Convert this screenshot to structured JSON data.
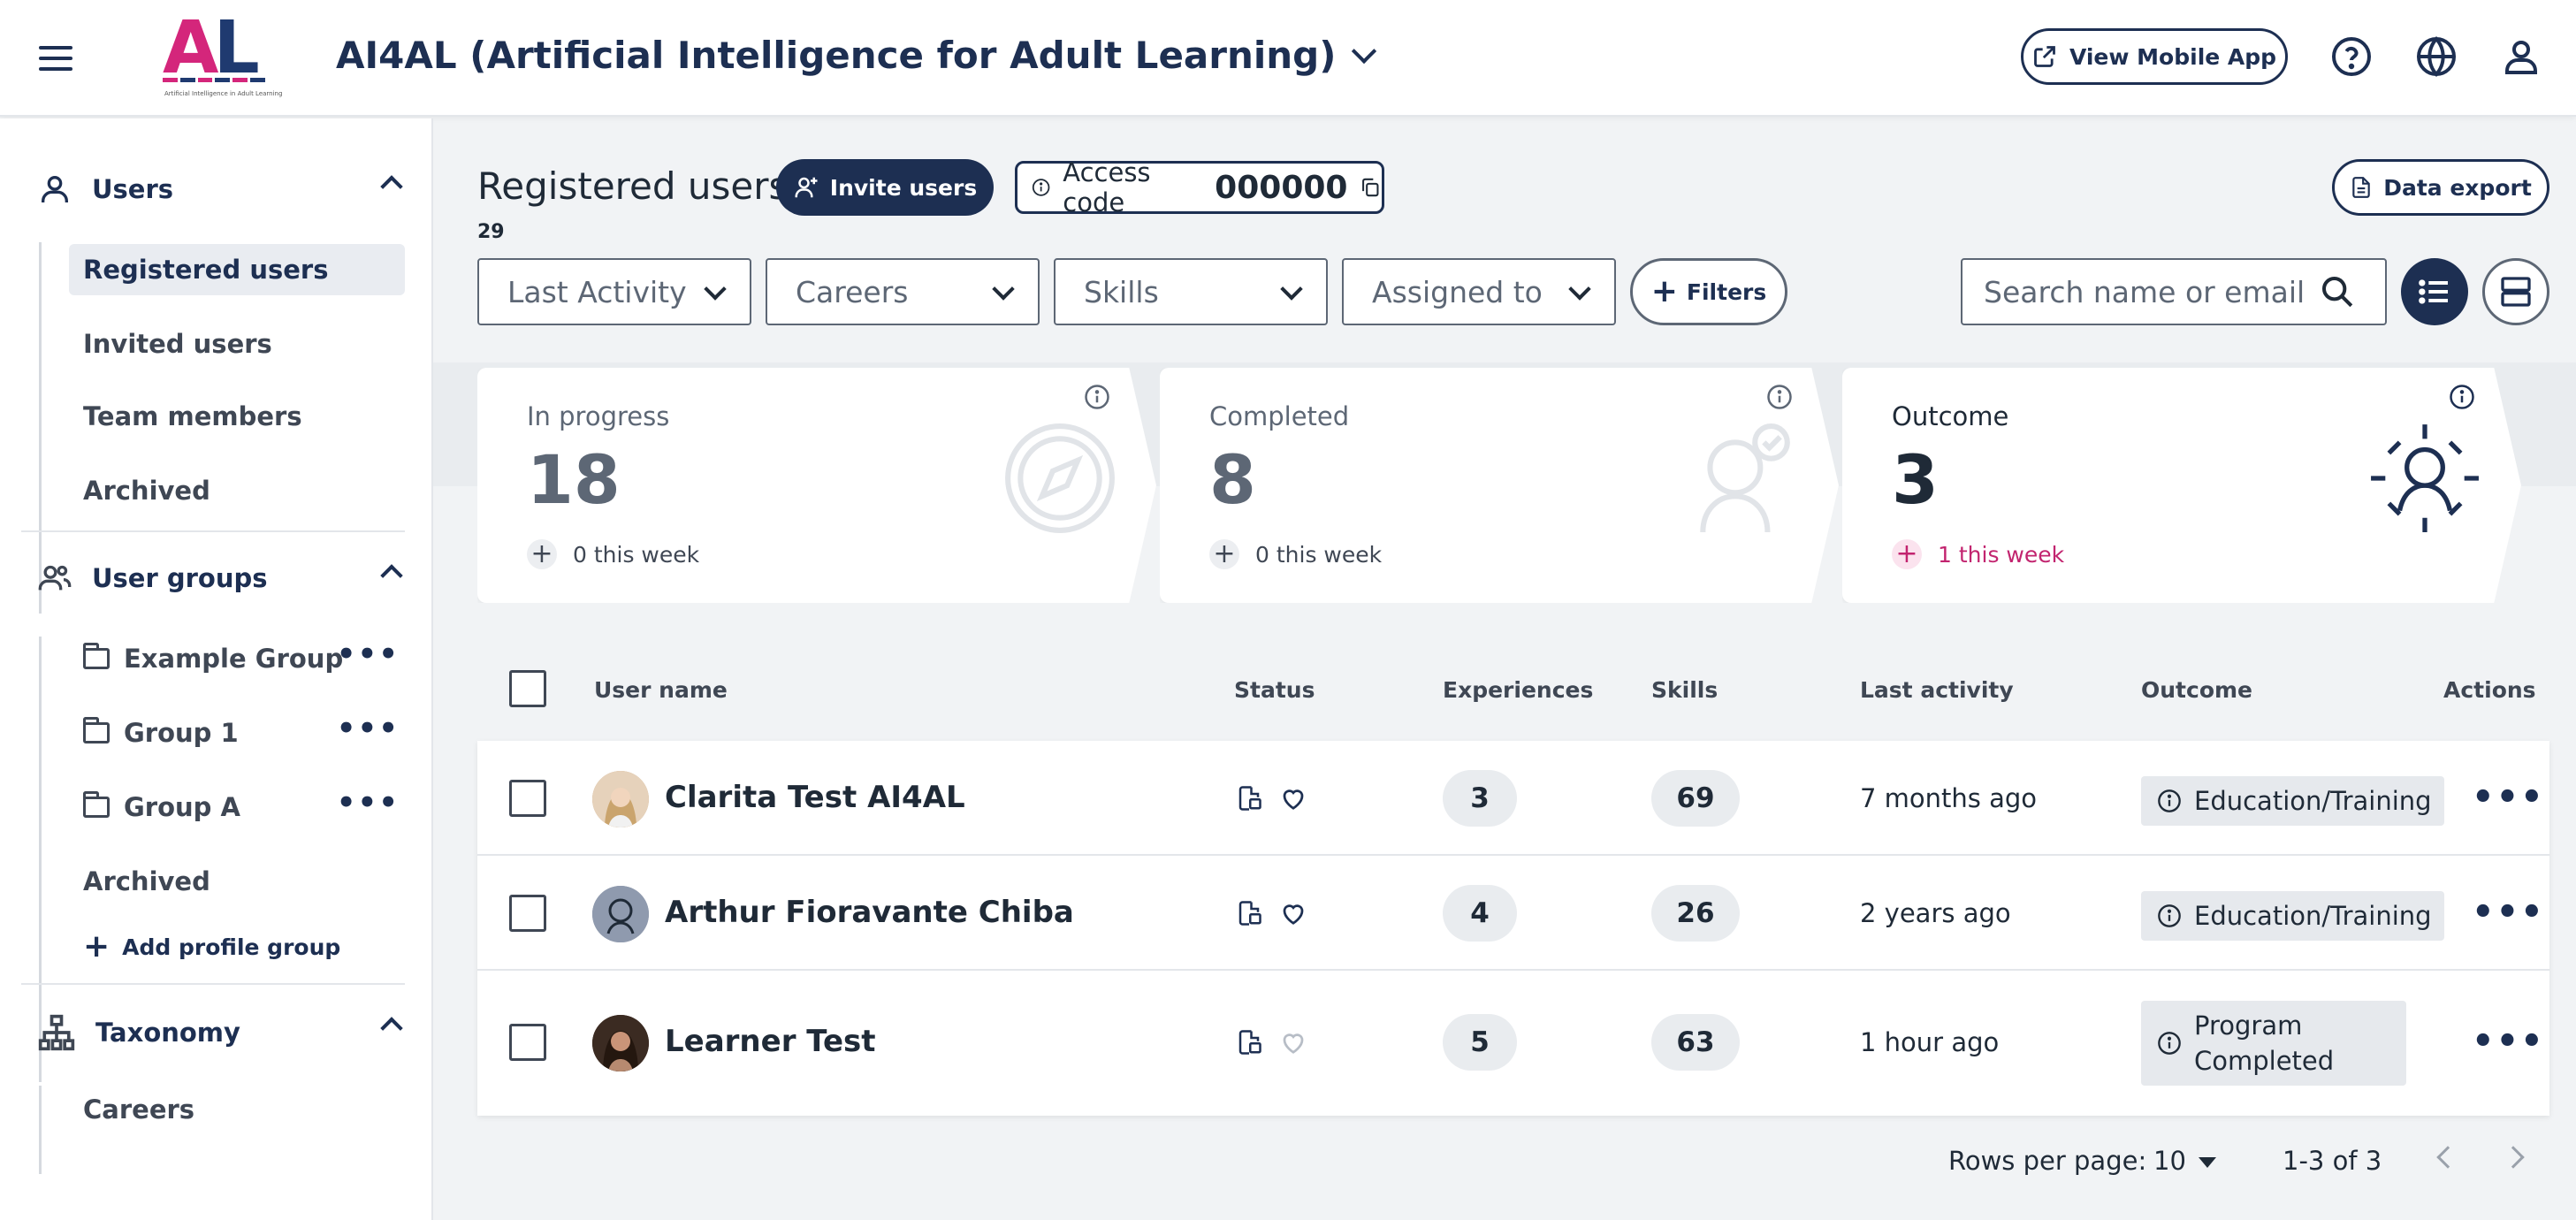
{
  "header": {
    "app_title": "AI4AL (Artificial Intelligence for Adult Learning)",
    "logo_text_a": "A",
    "logo_text_l": "L",
    "logo_subtitle": "Artificial Intelligence in Adult Learning",
    "view_mobile_app": "View Mobile App",
    "icons": [
      "menu-icon",
      "help-icon",
      "globe-icon",
      "user-icon"
    ]
  },
  "sidebar": {
    "users": {
      "title": "Users",
      "items": [
        "Registered users",
        "Invited users",
        "Team members",
        "Archived"
      ],
      "active": "Registered users"
    },
    "user_groups": {
      "title": "User groups",
      "items": [
        "Example Group",
        "Group 1",
        "Group A"
      ],
      "archived": "Archived",
      "add": "Add profile group"
    },
    "taxonomy": {
      "title": "Taxonomy",
      "items": [
        "Careers"
      ]
    }
  },
  "main": {
    "title": "Registered users",
    "count": "29",
    "invite_label": "Invite users",
    "access_label": "Access code",
    "access_code": "000000",
    "export_label": "Data export",
    "filters": {
      "last_activity": "Last Activity",
      "careers": "Careers",
      "skills": "Skills",
      "assigned_to": "Assigned to",
      "filters_btn": "Filters"
    },
    "search_placeholder": "Search name or email"
  },
  "stats": [
    {
      "label": "In progress",
      "value": "18",
      "week": "0 this week"
    },
    {
      "label": "Completed",
      "value": "8",
      "week": "0 this week"
    },
    {
      "label": "Outcome",
      "value": "3",
      "week": "1 this week"
    }
  ],
  "table": {
    "headers": [
      "User name",
      "Status",
      "Experiences",
      "Skills",
      "Last activity",
      "Outcome",
      "Actions"
    ],
    "rows": [
      {
        "name": "Clarita Test AI4AL",
        "experiences": "3",
        "skills": "69",
        "last_activity": "7 months ago",
        "outcome": "Education/Training"
      },
      {
        "name": "Arthur Fioravante Chiba",
        "experiences": "4",
        "skills": "26",
        "last_activity": "2 years ago",
        "outcome": "Education/Training"
      },
      {
        "name": "Learner Test",
        "experiences": "5",
        "skills": "63",
        "last_activity": "1 hour ago",
        "outcome_line1": "Program",
        "outcome_line2": "Completed"
      }
    ]
  },
  "pagination": {
    "rows_label": "Rows per page:",
    "rows_value": "10",
    "range": "1-3 of 3"
  },
  "colors": {
    "brand_navy": "#1d2f52",
    "brand_pink": "#d4267b",
    "background": "#f1f3f5"
  }
}
